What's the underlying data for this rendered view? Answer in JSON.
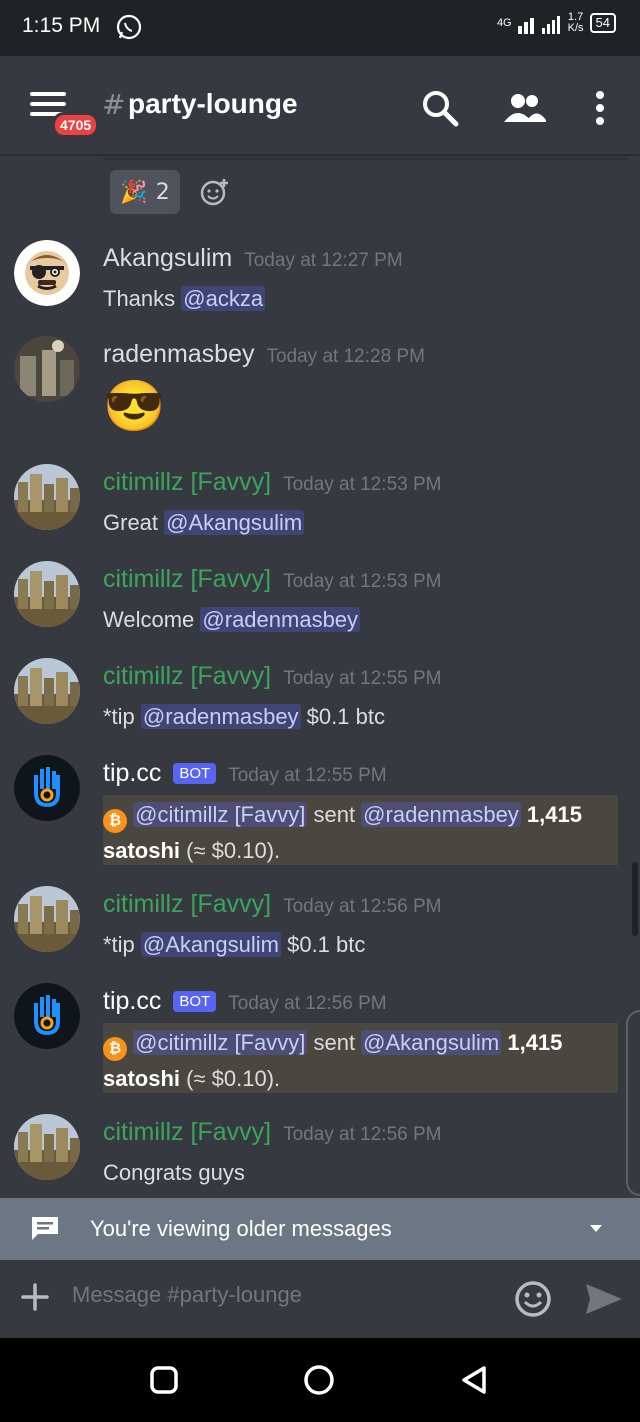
{
  "status_bar": {
    "time": "1:15 PM",
    "network_type": "4G",
    "speed_value": "1.7",
    "speed_unit": "K/s",
    "battery": "54"
  },
  "header": {
    "hash": "#",
    "channel": "party-lounge",
    "badge_count": "4705"
  },
  "reactions": [
    {
      "emoji": "🎉",
      "count": "2"
    }
  ],
  "messages": [
    {
      "username": "Akangsulim",
      "username_color": "#dcddde",
      "timestamp": "Today at 12:27 PM",
      "text": "Thanks ",
      "mention": "@ackza"
    },
    {
      "username": "radenmasbey",
      "username_color": "#dcddde",
      "timestamp": "Today at 12:28 PM",
      "emoji": "😎"
    },
    {
      "username": "citimillz [Favvy]",
      "username_color": "#3ba55c",
      "timestamp": "Today at 12:53 PM",
      "text": "Great ",
      "mention": "@Akangsulim"
    },
    {
      "username": "citimillz [Favvy]",
      "username_color": "#3ba55c",
      "timestamp": "Today at 12:53 PM",
      "text": "Welcome ",
      "mention": "@radenmasbey"
    },
    {
      "username": "citimillz [Favvy]",
      "username_color": "#3ba55c",
      "timestamp": "Today at 12:55 PM",
      "text": "*tip ",
      "mention": "@radenmasbey",
      "suffix": " $0.1 btc"
    },
    {
      "username": "tip.cc",
      "bot_tag": "BOT",
      "timestamp": "Today at 12:55 PM",
      "embed": {
        "sender": "@citimillz [Favvy]",
        "verb": " sent ",
        "recipient": "@radenmasbey",
        "amount": " 1,415",
        "line2_strong": "satoshi",
        "line2_rest": " (≈ $0.10)."
      }
    },
    {
      "username": "citimillz [Favvy]",
      "username_color": "#3ba55c",
      "timestamp": "Today at 12:56 PM",
      "text": "*tip ",
      "mention": "@Akangsulim",
      "suffix": " $0.1 btc"
    },
    {
      "username": "tip.cc",
      "bot_tag": "BOT",
      "timestamp": "Today at 12:56 PM",
      "embed": {
        "sender": "@citimillz [Favvy]",
        "verb": " sent ",
        "recipient": "@Akangsulim",
        "amount": " 1,415",
        "line2_strong": "satoshi",
        "line2_rest": " (≈ $0.10)."
      }
    },
    {
      "username": "citimillz [Favvy]",
      "username_color": "#3ba55c",
      "timestamp": "Today at 12:56 PM",
      "text": "Congrats guys"
    }
  ],
  "older_bar": {
    "text": "You're viewing older messages"
  },
  "composer": {
    "placeholder": "Message #party-lounge"
  },
  "colors": {
    "background": "#36393f",
    "mention": "#5865f2",
    "online_green": "#3ba55c",
    "badge_red": "#ed4245"
  }
}
